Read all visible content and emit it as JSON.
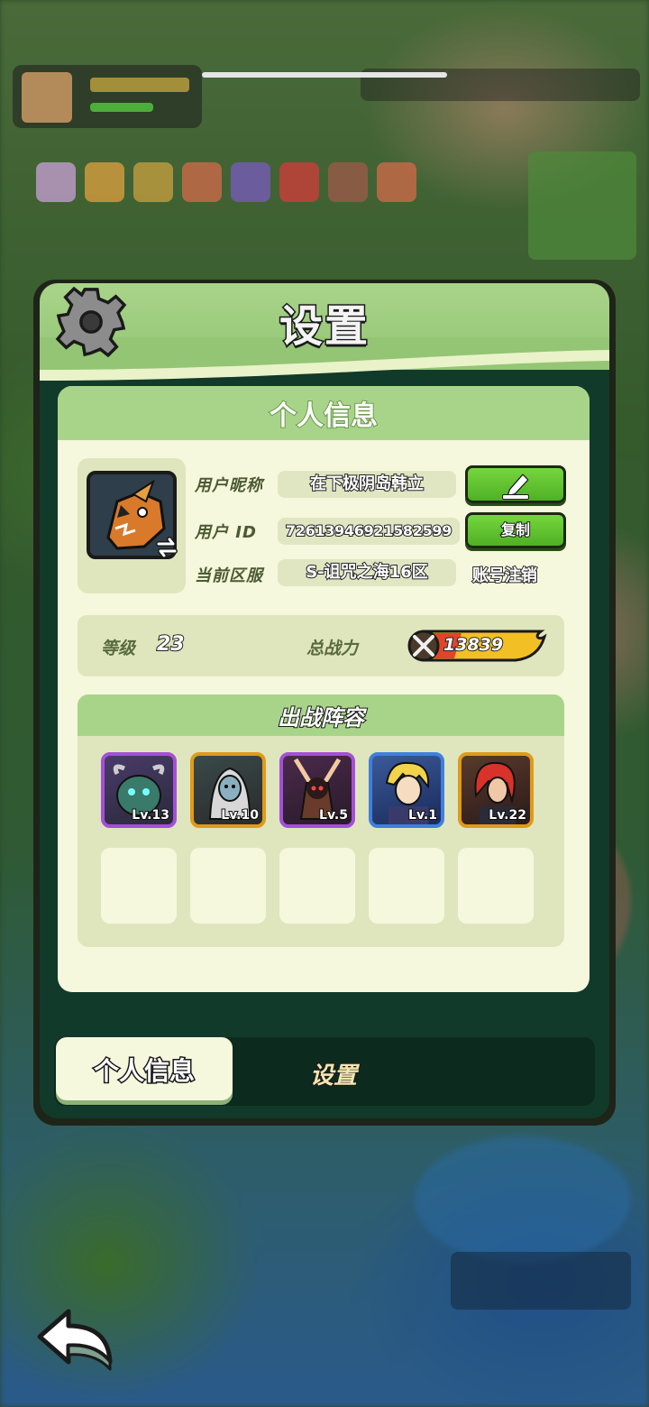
{
  "panel": {
    "title": "设置"
  },
  "profile_card": {
    "title": "个人信息",
    "nickname_label": "用户昵称",
    "nickname_value": "在下极阴岛韩立",
    "user_id_label": "用户 ID",
    "user_id_value": "72613946921582599",
    "copy_button": "复制",
    "server_label": "当前区服",
    "server_value": "S-诅咒之海16区",
    "deregister_link": "账号注销",
    "level_label": "等级",
    "level_value": "23",
    "power_label": "总战力",
    "power_value": "13839"
  },
  "lineup": {
    "title": "出战阵容",
    "heroes": [
      {
        "level": "Lv.13",
        "frame_color": "#a44fd9"
      },
      {
        "level": "Lv.10",
        "frame_color": "#e09a1a"
      },
      {
        "level": "Lv.5",
        "frame_color": "#a44fd9"
      },
      {
        "level": "Lv.1",
        "frame_color": "#3f7fe0"
      },
      {
        "level": "Lv.22",
        "frame_color": "#e09a1a"
      }
    ],
    "empty_slots": 5
  },
  "tabs": [
    {
      "label": "个人信息",
      "active": true
    },
    {
      "label": "设置",
      "active": false
    }
  ],
  "colors": {
    "panel_bg": "#123a2a",
    "header_green": "#a8d48a",
    "card_bg": "#f5f8dc",
    "button_green": "#5cc22e"
  },
  "icons": [
    "gear-icon",
    "pencil-edit-icon",
    "swap-avatar-icon",
    "swords-power-icon",
    "back-arrow-icon"
  ]
}
